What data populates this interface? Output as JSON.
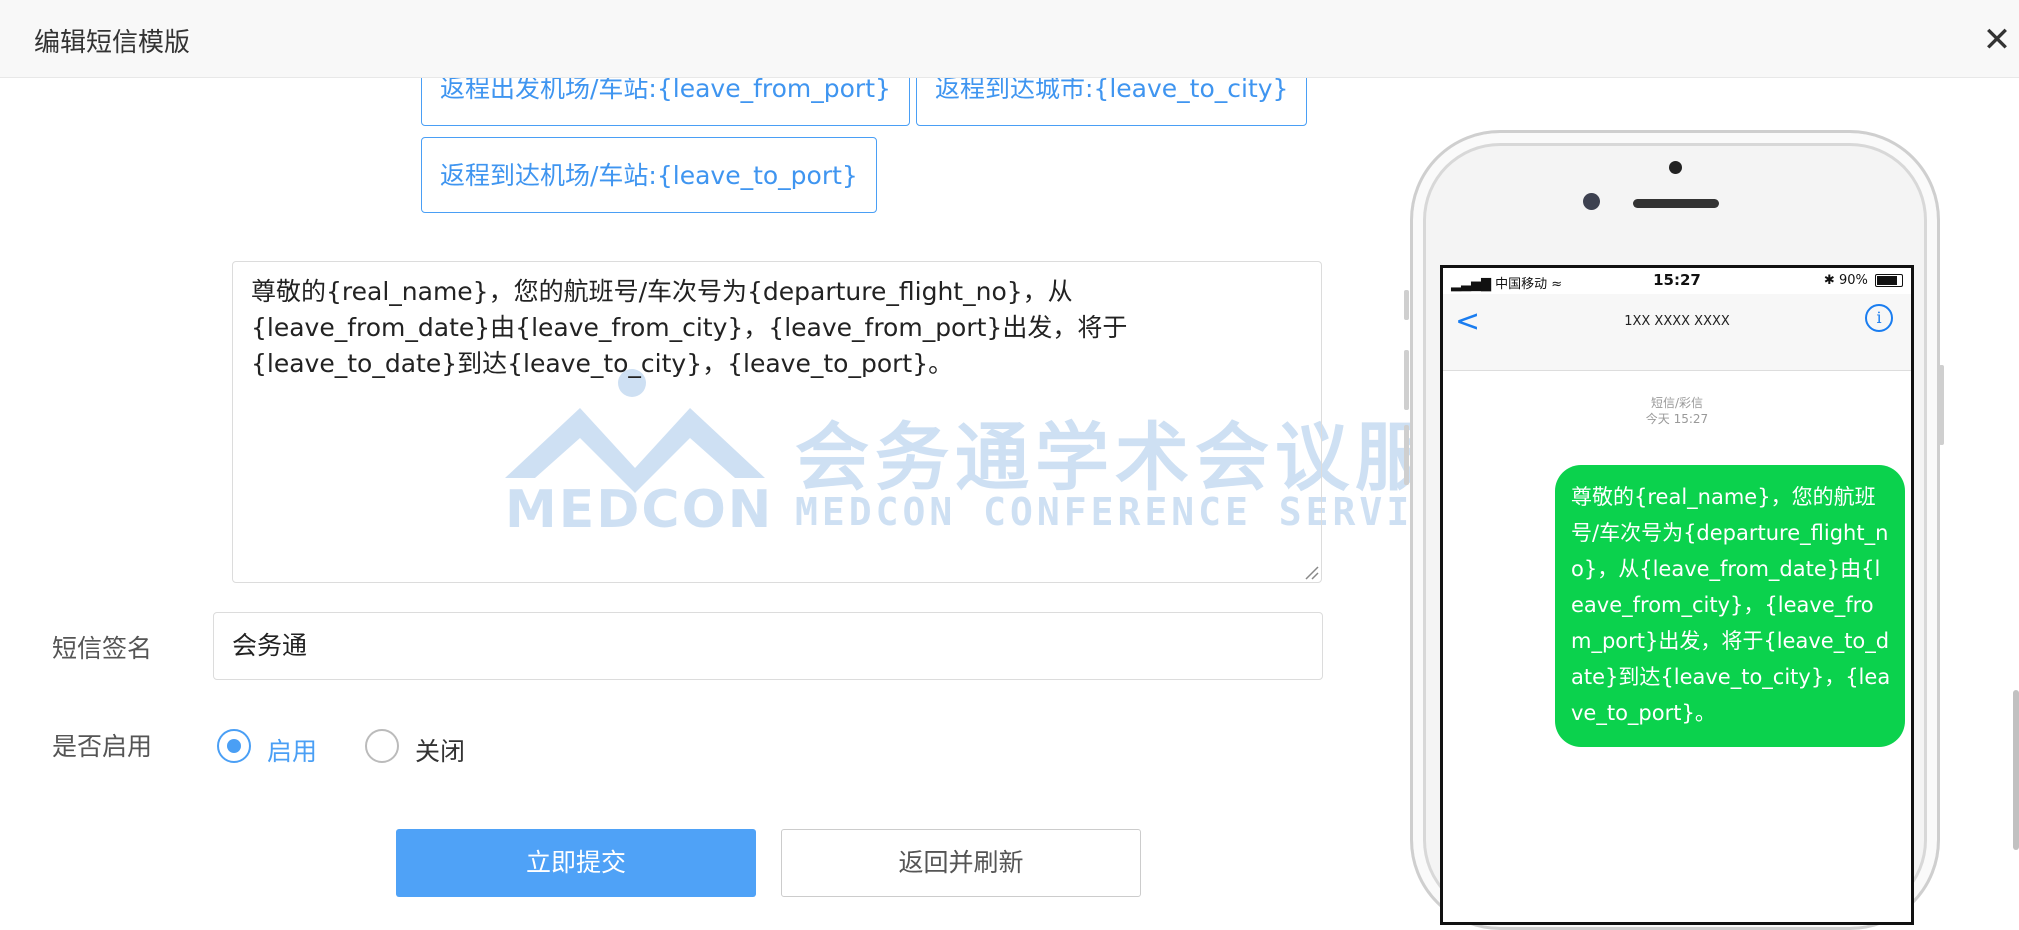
{
  "dialog": {
    "title": "编辑短信模版",
    "close_icon": "close-icon"
  },
  "variable_buttons": [
    "返程出发机场/车站:{leave_from_port}",
    "返程到达城市:{leave_to_city}",
    "返程到达机场/车站:{leave_to_port}"
  ],
  "message": {
    "content": "尊敬的{real_name}，您的航班号/车次号为{departure_flight_no}，从{leave_from_date}由{leave_from_city}，{leave_from_port}出发，将于{leave_to_date}到达{leave_to_city}，{leave_to_port}。"
  },
  "watermark": {
    "cn": "会务通学术会议服务平台",
    "en": "MEDCON CONFERENCE SERVICE PLATFORM",
    "brand": "MEDCON"
  },
  "form": {
    "signature_label": "短信签名",
    "signature_value": "会务通",
    "enable_label": "是否启用",
    "enable_on_label": "启用",
    "enable_off_label": "关闭",
    "enabled": true
  },
  "buttons": {
    "submit": "立即提交",
    "back_refresh": "返回并刷新"
  },
  "phone": {
    "carrier": "中国移动",
    "time": "15:27",
    "battery": "90%",
    "contact": "1XX XXXX XXXX",
    "msg_type": "短信/彩信",
    "msg_time": "今天 15:27",
    "bubble_text": "尊敬的{real_name}，您的航班号/车次号为{departure_flight_no}，从{leave_from_date}由{leave_from_city}，{leave_from_port}出发，将于{leave_to_date}到达{leave_to_city}，{leave_to_port}。"
  },
  "colors": {
    "accent": "#4fa2f7",
    "bubble_green": "#0bd24d",
    "ios_blue": "#1a7df0"
  }
}
